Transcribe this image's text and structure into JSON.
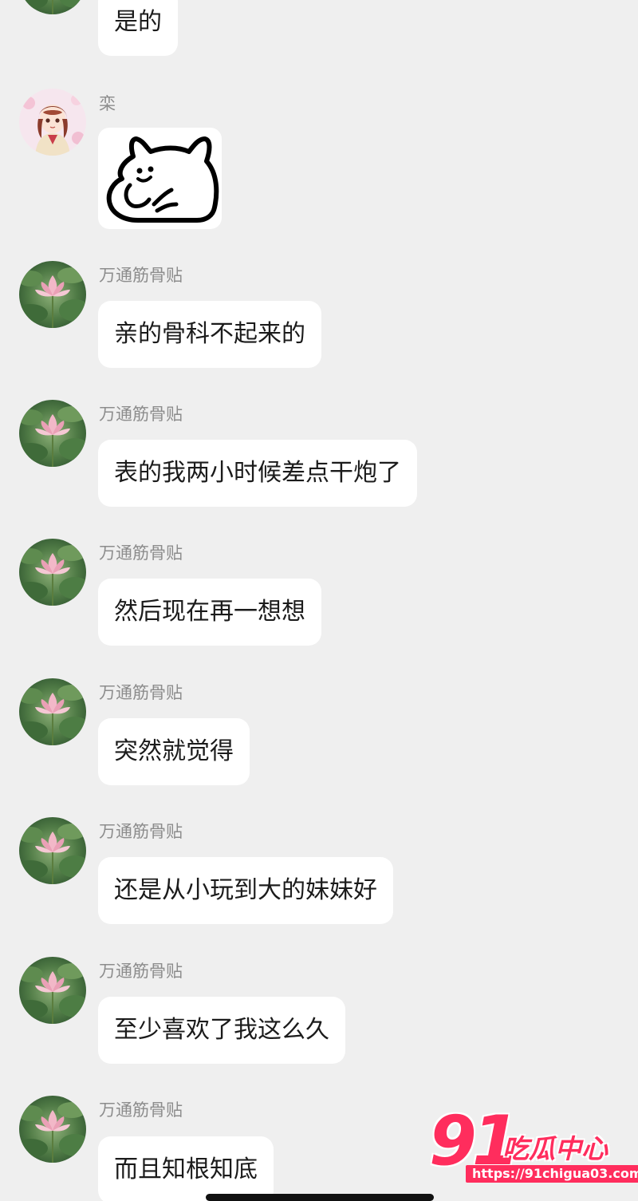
{
  "messages": [
    {
      "sender": "",
      "avatar": "lotus-avatar",
      "text": "是的"
    },
    {
      "sender": "栾",
      "avatar": "anime-girl-avatar",
      "sticker": "cat-sticker"
    },
    {
      "sender": "万通筋骨贴",
      "avatar": "lotus-avatar",
      "text": "亲的骨科不起来的"
    },
    {
      "sender": "万通筋骨贴",
      "avatar": "lotus-avatar",
      "text": "表的我两小时候差点干炮了"
    },
    {
      "sender": "万通筋骨贴",
      "avatar": "lotus-avatar",
      "text": "然后现在再一想想"
    },
    {
      "sender": "万通筋骨贴",
      "avatar": "lotus-avatar",
      "text": "突然就觉得"
    },
    {
      "sender": "万通筋骨贴",
      "avatar": "lotus-avatar",
      "text": "还是从小玩到大的妹妹好"
    },
    {
      "sender": "万通筋骨贴",
      "avatar": "lotus-avatar",
      "text": "至少喜欢了我这么久"
    },
    {
      "sender": "万通筋骨贴",
      "avatar": "lotus-avatar",
      "text": "而且知根知底"
    }
  ],
  "watermark": {
    "number": "91",
    "title": "吃瓜中心",
    "url": "https://91chigua03.com"
  },
  "colors": {
    "background": "#efefef",
    "bubble": "#ffffff",
    "sender_name": "#8c8c8c",
    "watermark": "#ff2d5d"
  }
}
